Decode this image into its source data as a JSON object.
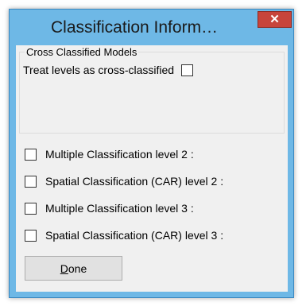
{
  "window": {
    "title": "Classification Inform…",
    "close_glyph": "✕"
  },
  "group": {
    "legend": "Cross Classified Models",
    "treat_label": "Treat levels as cross-classified",
    "treat_checked": false
  },
  "options": [
    {
      "label": "Multiple Classification level 2 :",
      "checked": false
    },
    {
      "label": "Spatial Classification (CAR) level 2 :",
      "checked": false
    },
    {
      "label": "Multiple Classification level 3 :",
      "checked": false
    },
    {
      "label": "Spatial Classification (CAR) level 3 :",
      "checked": false
    }
  ],
  "done_button": {
    "mnemonic": "D",
    "rest": "one"
  }
}
